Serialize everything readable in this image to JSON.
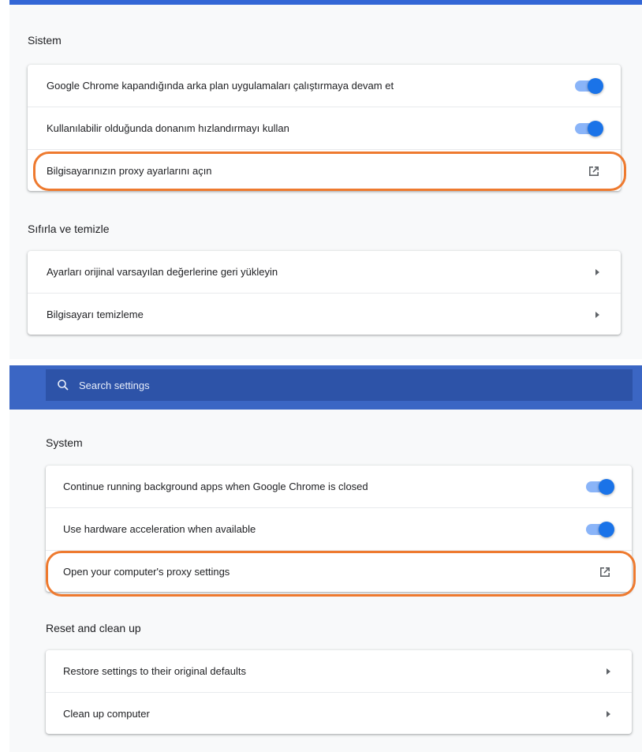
{
  "colors": {
    "accent": "#1a73e8",
    "header_blue": "#3b66c4",
    "highlight_orange": "#ee7a2f"
  },
  "turkish": {
    "system_title": "Sistem",
    "system_rows": [
      {
        "label": "Google Chrome kapandığında arka plan uygulamaları çalıştırmaya devam et",
        "control": "toggle",
        "on": true
      },
      {
        "label": "Kullanılabilir olduğunda donanım hızlandırmayı kullan",
        "control": "toggle",
        "on": true
      },
      {
        "label": "Bilgisayarınızın proxy ayarlarını açın",
        "control": "external-link-icon"
      }
    ],
    "reset_title": "Sıfırla ve temizle",
    "reset_rows": [
      {
        "label": "Ayarları orijinal varsayılan değerlerine geri yükleyin",
        "control": "chevron-right-icon"
      },
      {
        "label": "Bilgisayarı temizleme",
        "control": "chevron-right-icon"
      }
    ]
  },
  "english": {
    "search": {
      "placeholder": "Search settings",
      "icon": "search-icon"
    },
    "system_title": "System",
    "system_rows": [
      {
        "label": "Continue running background apps when Google Chrome is closed",
        "control": "toggle",
        "on": true
      },
      {
        "label": "Use hardware acceleration when available",
        "control": "toggle",
        "on": true
      },
      {
        "label": "Open your computer's proxy settings",
        "control": "external-link-icon"
      }
    ],
    "reset_title": "Reset and clean up",
    "reset_rows": [
      {
        "label": "Restore settings to their original defaults",
        "control": "chevron-right-icon"
      },
      {
        "label": "Clean up computer",
        "control": "chevron-right-icon"
      }
    ]
  }
}
